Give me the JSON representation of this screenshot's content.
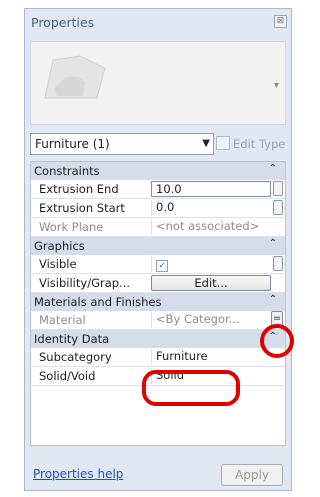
{
  "panel": {
    "title": "Properties",
    "close_glyph": "⊠",
    "preview_icon": "chevron-down-icon"
  },
  "type_selector": {
    "value": "Furniture (1)",
    "edit_type_label": "Edit Type"
  },
  "groups": [
    {
      "label": "Constraints"
    },
    {
      "label": "Graphics"
    },
    {
      "label": "Materials and Finishes"
    },
    {
      "label": "Identity Data"
    }
  ],
  "rows": {
    "extrusion_end": {
      "name": "Extrusion End",
      "value": "10.0"
    },
    "extrusion_start": {
      "name": "Extrusion Start",
      "value": "0.0"
    },
    "work_plane": {
      "name": "Work Plane",
      "value": "<not associated>"
    },
    "visible": {
      "name": "Visible",
      "checked": true
    },
    "visibility": {
      "name": "Visibility/Grap...",
      "button": "Edit..."
    },
    "material": {
      "name": "Material",
      "value": "<By Categor..."
    },
    "subcategory": {
      "name": "Subcategory",
      "value": "Furniture"
    },
    "solid_void": {
      "name": "Solid/Void",
      "value": "Solid"
    }
  },
  "footer": {
    "help_link": "Properties help",
    "apply_label": "Apply"
  },
  "colors": {
    "annotation_red": "#e00000",
    "header_blue": "#d4dde9"
  }
}
